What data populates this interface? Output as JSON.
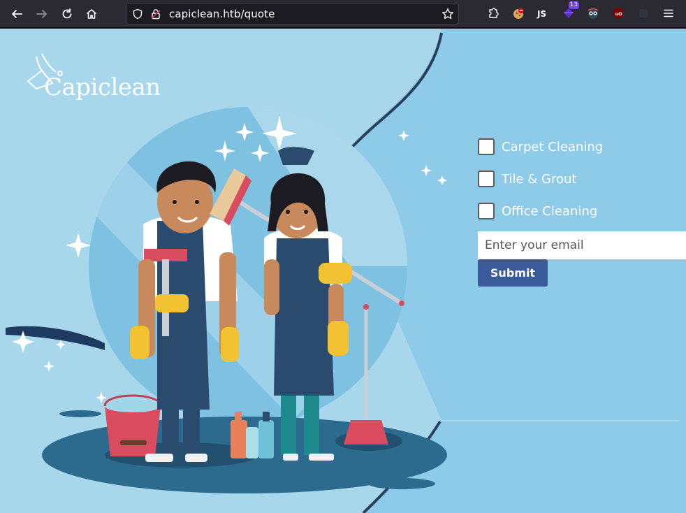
{
  "browser": {
    "url": "capiclean.htb/quote",
    "extension_badge": "13"
  },
  "logo": {
    "name": "Capiclean"
  },
  "form": {
    "services": [
      {
        "label": "Carpet Cleaning",
        "checked": false
      },
      {
        "label": "Tile & Grout",
        "checked": false
      },
      {
        "label": "Office Cleaning",
        "checked": false
      }
    ],
    "email_placeholder": "Enter your email",
    "submit_label": "Submit"
  },
  "colors": {
    "page_bg": "#a8d7ec",
    "panel_bg": "#8ecbe8",
    "submit_bg": "#3b5a9a",
    "toolbar_bg": "#2b2a33"
  }
}
